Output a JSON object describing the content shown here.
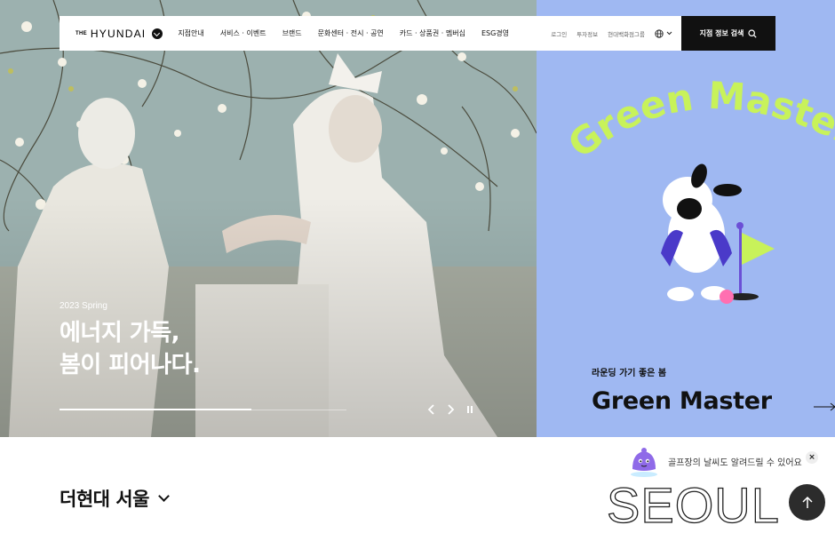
{
  "header": {
    "logo_the": "THE",
    "logo_name": "HYUNDAI",
    "nav": [
      "지점안내",
      "서비스 · 이벤트",
      "브랜드",
      "문화센터 · 전시 · 공연",
      "카드 · 상품권 · 멤버십",
      "ESG경영"
    ],
    "util": [
      "로그인",
      "투자정보",
      "현대백화점그룹"
    ],
    "store_search_label": "지점 정보 검색"
  },
  "hero": {
    "eyebrow": "2023 Spring",
    "title_line1": "에너지 가득,",
    "title_line2": "봄이 피어나다.",
    "progress": 0.67
  },
  "promo": {
    "arc_text": "Green Master",
    "subtitle": "라운딩 가기 좋은 봄",
    "title": "Green Master",
    "background": "#9fb8f2",
    "arc_color": "#c8f25a"
  },
  "branch": {
    "title": "더현대 서울",
    "city": "SEOUL"
  },
  "chat": {
    "message": "골프장의 날씨도 알려드릴 수 있어요",
    "close": "×"
  }
}
